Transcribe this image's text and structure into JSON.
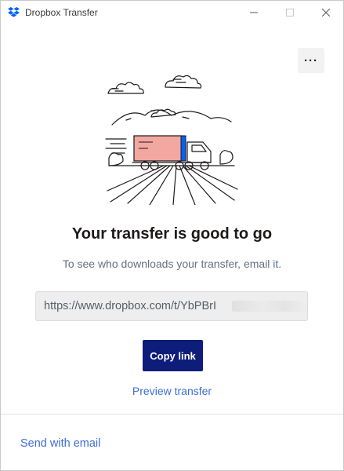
{
  "window": {
    "title": "Dropbox Transfer",
    "controls": {
      "minimize_icon": "minimize-icon",
      "maximize_icon": "maximize-icon",
      "close_icon": "close-icon"
    }
  },
  "colors": {
    "brand_blue": "#0061fe",
    "button_navy": "#0f1d7a",
    "link_blue": "#3d6fd6",
    "cargo_pink": "#f2a8a0"
  },
  "more_menu": {
    "label": "···",
    "icon": "ellipsis-icon"
  },
  "illustration": {
    "icon": "delivery-truck-illustration"
  },
  "main": {
    "headline": "Your transfer is good to go",
    "subtext": "To see who downloads your transfer, email it.",
    "link_value": "https://www.dropbox.com/t/YbPBrI",
    "copy_button": "Copy link",
    "preview_link": "Preview transfer"
  },
  "footer": {
    "send_email": "Send with email"
  }
}
